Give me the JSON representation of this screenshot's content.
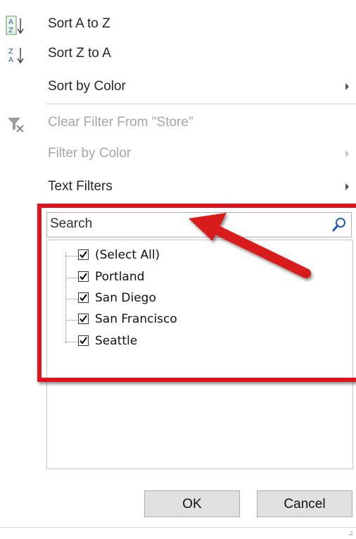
{
  "menu": {
    "sort_az": "Sort A to Z",
    "sort_za": "Sort Z to A",
    "sort_by_color": "Sort by Color",
    "clear_filter": "Clear Filter From \"Store\"",
    "filter_by_color": "Filter by Color",
    "text_filters": "Text Filters"
  },
  "search": {
    "placeholder": "Search"
  },
  "list": {
    "items": [
      "(Select All)",
      "Portland",
      "San Diego",
      "San Francisco",
      "Seattle"
    ],
    "all_checked": true
  },
  "buttons": {
    "ok": "OK",
    "cancel": "Cancel"
  },
  "colors": {
    "highlight": "#e0121b",
    "arrow": "#d81e1e",
    "sort_icon_blue": "#1f5fa8"
  },
  "icons": {
    "sort_az": "sort-ascending-icon",
    "sort_za": "sort-descending-icon",
    "clear_filter": "clear-filter-icon",
    "search": "magnifier-icon"
  }
}
